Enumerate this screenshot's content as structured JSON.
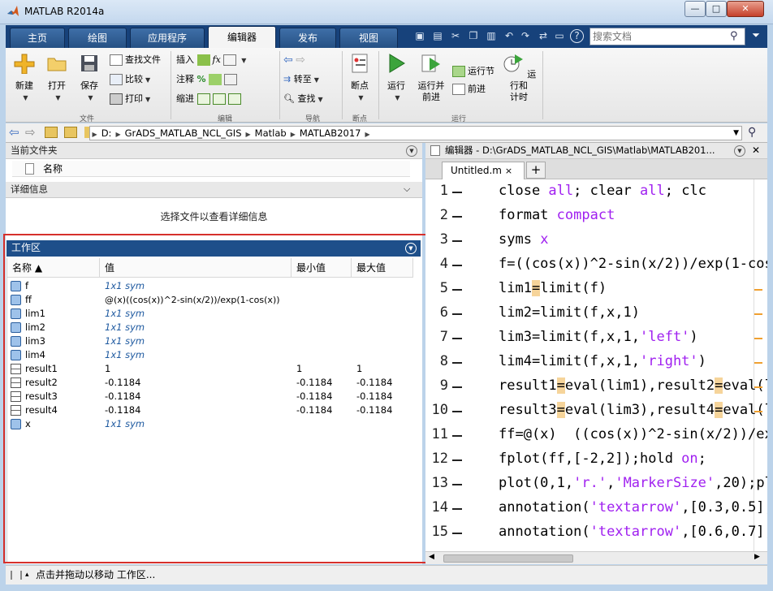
{
  "window": {
    "title": "MATLAB R2014a",
    "min": "—",
    "max": "□",
    "close": "✕"
  },
  "tabs": [
    {
      "label": "主页"
    },
    {
      "label": "绘图"
    },
    {
      "label": "应用程序"
    },
    {
      "label": "编辑器"
    },
    {
      "label": "发布"
    },
    {
      "label": "视图"
    }
  ],
  "search": {
    "placeholder": "搜索文档"
  },
  "toolstrip": {
    "file": {
      "new": "新建",
      "open": "打开",
      "save": "保存",
      "find_files": "查找文件",
      "compare": "比较",
      "print": "打印",
      "label": "文件"
    },
    "edit": {
      "insert": "插入",
      "fx": "fx",
      "comment": "注释",
      "percent": "%",
      "indent": "缩进",
      "label": "编辑"
    },
    "nav": {
      "goto": "转至",
      "find": "查找",
      "label": "导航"
    },
    "breakpoints": {
      "bp": "断点",
      "label": "断点"
    },
    "run": {
      "run": "运行",
      "run_advance_1": "运行并",
      "run_advance_2": "前进",
      "run_section": "运行节",
      "advance": "前进",
      "run_time_1": "运行和",
      "run_time_2": "计时",
      "label": "运行"
    }
  },
  "address": {
    "crumbs": [
      "D:",
      "GrADS_MATLAB_NCL_GIS",
      "Matlab",
      "MATLAB2017"
    ]
  },
  "current_folder": {
    "title": "当前文件夹",
    "name_col": "名称"
  },
  "details": {
    "title": "详细信息",
    "hint": "选择文件以查看详细信息"
  },
  "workspace": {
    "title": "工作区",
    "columns": {
      "name": "名称 ▲",
      "value": "值",
      "min": "最小值",
      "max": "最大值"
    },
    "rows": [
      {
        "name": "f",
        "value": "1x1 sym",
        "min": "",
        "max": "",
        "type": "sym"
      },
      {
        "name": "ff",
        "value": "@(x)((cos(x))^2-sin(x/2))/exp(1-cos(x))",
        "min": "",
        "max": "",
        "type": "fn"
      },
      {
        "name": "lim1",
        "value": "1x1 sym",
        "min": "",
        "max": "",
        "type": "sym"
      },
      {
        "name": "lim2",
        "value": "1x1 sym",
        "min": "",
        "max": "",
        "type": "sym"
      },
      {
        "name": "lim3",
        "value": "1x1 sym",
        "min": "",
        "max": "",
        "type": "sym"
      },
      {
        "name": "lim4",
        "value": "1x1 sym",
        "min": "",
        "max": "",
        "type": "sym"
      },
      {
        "name": "result1",
        "value": "1",
        "min": "1",
        "max": "1",
        "type": "num"
      },
      {
        "name": "result2",
        "value": "-0.1184",
        "min": "-0.1184",
        "max": "-0.1184",
        "type": "num"
      },
      {
        "name": "result3",
        "value": "-0.1184",
        "min": "-0.1184",
        "max": "-0.1184",
        "type": "num"
      },
      {
        "name": "result4",
        "value": "-0.1184",
        "min": "-0.1184",
        "max": "-0.1184",
        "type": "num"
      },
      {
        "name": "x",
        "value": "1x1 sym",
        "min": "",
        "max": "",
        "type": "sym"
      }
    ]
  },
  "editor": {
    "title": "编辑器 - D:\\GrADS_MATLAB_NCL_GIS\\Matlab\\MATLAB201...",
    "tab": "Untitled.m",
    "tab_close": "×",
    "add_tab": "+",
    "lines": [
      "1",
      "2",
      "3",
      "4",
      "5",
      "6",
      "7",
      "8",
      "9",
      "10",
      "11",
      "12",
      "13",
      "14",
      "15"
    ]
  },
  "status": {
    "text": "点击并拖动以移动 工作区..."
  },
  "colors": {
    "ribbon_blue": "#17427b",
    "highlight_red": "#d6302b",
    "keyword": "#a020f0"
  }
}
